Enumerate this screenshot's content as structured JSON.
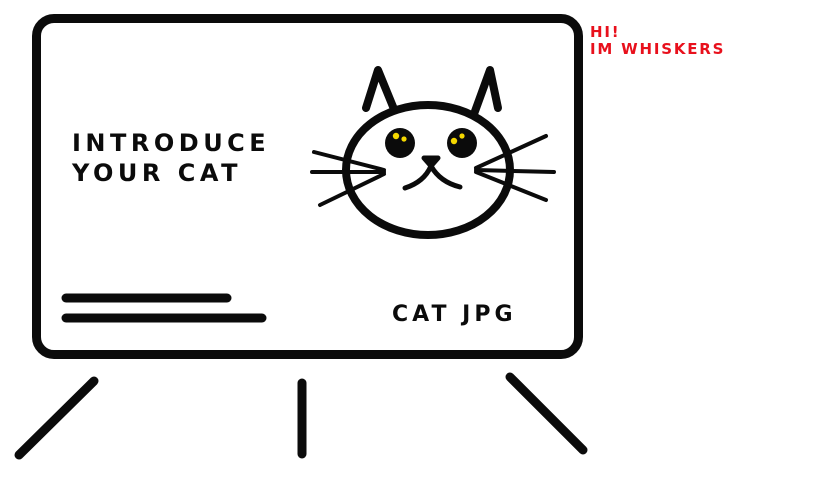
{
  "card": {
    "headline_line1": "INTRODUCE",
    "headline_line2": "YOUR CAT",
    "caption": "CAT JPG"
  },
  "greeting": {
    "line1": "HI!",
    "line2": "IM WHISKERS"
  },
  "colors": {
    "ink": "#0b0b0b",
    "accent_red": "#e8101c",
    "eye_highlight": "#f5d800",
    "background": "#ffffff"
  },
  "icons": {
    "cat_face": "cat-face-icon",
    "stand_legs": "easel-leg-icon"
  }
}
